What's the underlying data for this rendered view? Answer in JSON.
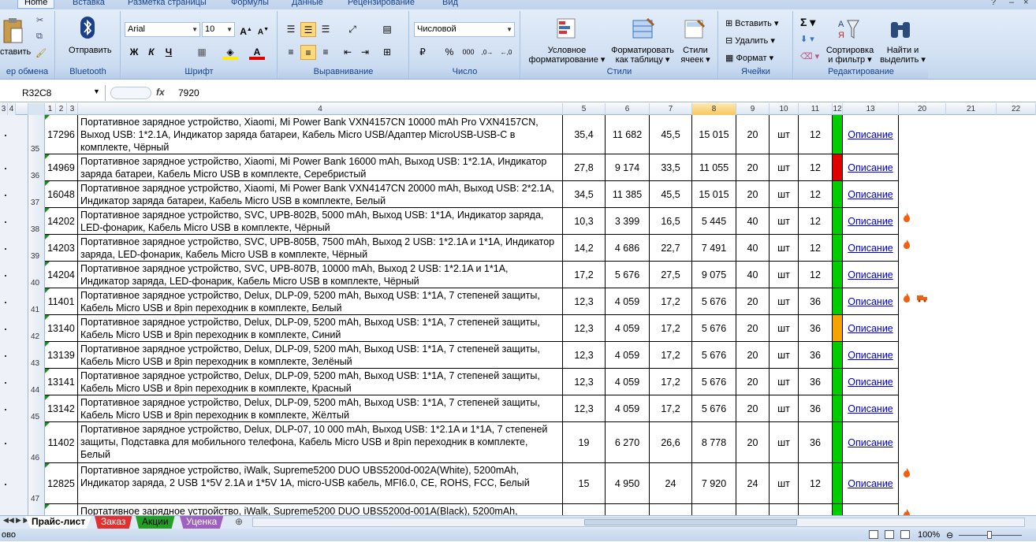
{
  "ribbon": {
    "tabs": [
      "Home",
      "Вставка",
      "Разметка страницы",
      "Формулы",
      "Данные",
      "Рецензирование",
      "Вид"
    ],
    "clipboard": {
      "paste": "ставить",
      "label": "ер обмена"
    },
    "bluetooth": {
      "send": "Отправить",
      "label": "Bluetooth"
    },
    "font": {
      "name": "Arial",
      "size": "10",
      "label": "Шрифт",
      "bold": "Ж",
      "italic": "К",
      "underline": "Ч"
    },
    "align": {
      "label": "Выравнивание"
    },
    "number": {
      "format": "Числовой",
      "label": "Число"
    },
    "styles": {
      "cond": "Условное",
      "cond2": "форматирование",
      "table": "Форматировать",
      "table2": "как таблицу",
      "cell": "Стили",
      "cell2": "ячеек",
      "label": "Стили"
    },
    "cells": {
      "insert": "Вставить",
      "delete": "Удалить",
      "format": "Формат",
      "label": "Ячейки"
    },
    "edit": {
      "sort": "Сортировка",
      "sort2": "и фильтр",
      "find": "Найти и",
      "find2": "выделить",
      "label": "Редактирование"
    }
  },
  "formula_bar": {
    "name_box": "R32C8",
    "fx": "fx",
    "value": "7920"
  },
  "column_headers": {
    "levels": [
      "3",
      "4"
    ],
    "sub": [
      "1",
      "2",
      "3"
    ],
    "cols": [
      "4",
      "5",
      "6",
      "7",
      "8",
      "9",
      "10",
      "11",
      "12",
      "13",
      "20",
      "21",
      "22"
    ]
  },
  "rows": [
    {
      "num": "35",
      "code": "17296",
      "desc": "Портативное зарядное устройство, Xiaomi, Mi Power Bank VXN4157CN 10000 mAh Pro VXN4157CN, Выход USB: 1*2.1A, Индикатор заряда батареи, Кабель Micro USB/Адаптер MicroUSB-USB-C в комплекте, Чёрный",
      "c5": "35,4",
      "c6": "11 682",
      "c7": "45,5",
      "c8": "15 015",
      "c9": "20",
      "c10": "шт",
      "c11": "12",
      "status": "#00cc00",
      "link": "Описание",
      "flames": 0
    },
    {
      "num": "36",
      "code": "14969",
      "desc": "Портативное зарядное устройство, Xiaomi, Mi Power Bank 16000 mAh, Выход USB: 1*2.1A, Индикатор заряда батареи, Кабель Micro USB в комплекте, Серебристый",
      "c5": "27,8",
      "c6": "9 174",
      "c7": "33,5",
      "c8": "11 055",
      "c9": "20",
      "c10": "шт",
      "c11": "12",
      "status": "#e00000",
      "link": "Описание",
      "flames": 0
    },
    {
      "num": "37",
      "code": "16048",
      "desc": "Портативное зарядное устройство, Xiaomi, Mi Power Bank VXN4147CN 20000 mAh, Выход USB: 2*2.1A, Индикатор заряда батареи, Кабель Micro USB в комплекте, Белый",
      "c5": "34,5",
      "c6": "11 385",
      "c7": "45,5",
      "c8": "15 015",
      "c9": "20",
      "c10": "шт",
      "c11": "12",
      "status": "#00cc00",
      "link": "Описание",
      "flames": 0
    },
    {
      "num": "38",
      "code": "14202",
      "desc": "Портативное зарядное устройство, SVC, UPB-802B, 5000 mAh, Выход USB: 1*1A, Индикатор заряда, LED-фонарик, Кабель Micro USB в комплекте, Чёрный",
      "c5": "10,3",
      "c6": "3 399",
      "c7": "16,5",
      "c8": "5 445",
      "c9": "40",
      "c10": "шт",
      "c11": "12",
      "status": "#00cc00",
      "link": "Описание",
      "flames": 1
    },
    {
      "num": "39",
      "code": "14203",
      "desc": "Портативное зарядное устройство, SVC, UPB-805B, 7500 mAh, Выход 2 USB: 1*2.1A и 1*1A, Индикатор заряда, LED-фонарик, Кабель Micro USB в комплекте, Чёрный",
      "c5": "14,2",
      "c6": "4 686",
      "c7": "22,7",
      "c8": "7 491",
      "c9": "40",
      "c10": "шт",
      "c11": "12",
      "status": "#00cc00",
      "link": "Описание",
      "flames": 1
    },
    {
      "num": "40",
      "code": "14204",
      "desc": "Портативное зарядное устройство, SVC, UPB-807B, 10000 mAh, Выход 2 USB: 1*2.1A и 1*1A, Индикатор заряда, LED-фонарик, Кабель Micro USB в комплекте, Чёрный",
      "c5": "17,2",
      "c6": "5 676",
      "c7": "27,5",
      "c8": "9 075",
      "c9": "40",
      "c10": "шт",
      "c11": "12",
      "status": "#00cc00",
      "link": "Описание",
      "flames": 0
    },
    {
      "num": "41",
      "code": "11401",
      "desc": "Портативное зарядное устройство, Delux, DLP-09, 5200 mAh, Выход USB: 1*1A, 7 степеней защиты, Кабель Micro USB и 8pin переходник в комплекте, Белый",
      "c5": "12,3",
      "c6": "4 059",
      "c7": "17,2",
      "c8": "5 676",
      "c9": "20",
      "c10": "шт",
      "c11": "36",
      "status": "#00cc00",
      "link": "Описание",
      "flames": 2
    },
    {
      "num": "42",
      "code": "13140",
      "desc": "Портативное зарядное устройство, Delux, DLP-09, 5200 mAh, Выход USB: 1*1A, 7 степеней защиты, Кабель Micro USB и 8pin переходник в комплекте, Синий",
      "c5": "12,3",
      "c6": "4 059",
      "c7": "17,2",
      "c8": "5 676",
      "c9": "20",
      "c10": "шт",
      "c11": "36",
      "status": "#f4a300",
      "link": "Описание",
      "flames": 0
    },
    {
      "num": "43",
      "code": "13139",
      "desc": "Портативное зарядное устройство, Delux, DLP-09, 5200 mAh, Выход USB: 1*1A, 7 степеней защиты, Кабель Micro USB и 8pin переходник в комплекте, Зелёный",
      "c5": "12,3",
      "c6": "4 059",
      "c7": "17,2",
      "c8": "5 676",
      "c9": "20",
      "c10": "шт",
      "c11": "36",
      "status": "#00cc00",
      "link": "Описание",
      "flames": 0
    },
    {
      "num": "44",
      "code": "13141",
      "desc": "Портативное зарядное устройство, Delux, DLP-09, 5200 mAh, Выход USB: 1*1A, 7 степеней защиты, Кабель Micro USB и 8pin переходник в комплекте, Красный",
      "c5": "12,3",
      "c6": "4 059",
      "c7": "17,2",
      "c8": "5 676",
      "c9": "20",
      "c10": "шт",
      "c11": "36",
      "status": "#00cc00",
      "link": "Описание",
      "flames": 0
    },
    {
      "num": "45",
      "code": "13142",
      "desc": "Портативное зарядное устройство, Delux, DLP-09, 5200 mAh, Выход USB: 1*1A, 7 степеней защиты, Кабель Micro USB и 8pin переходник в комплекте, Жёлтый",
      "c5": "12,3",
      "c6": "4 059",
      "c7": "17,2",
      "c8": "5 676",
      "c9": "20",
      "c10": "шт",
      "c11": "36",
      "status": "#00cc00",
      "link": "Описание",
      "flames": 0
    },
    {
      "num": "46",
      "code": "11402",
      "desc": "Портативное зарядное устройство, Delux, DLP-07, 10 000 mAh, Выход USB: 1*2.1A и 1*1A, 7 степеней защиты, Подставка для мобильного телефона, Кабель Micro USB и 8pin переходник в комплекте, Белый",
      "c5": "19",
      "c6": "6 270",
      "c7": "26,6",
      "c8": "8 778",
      "c9": "20",
      "c10": "шт",
      "c11": "36",
      "status": "#00cc00",
      "link": "Описание",
      "flames": 0
    },
    {
      "num": "47",
      "code": "12825",
      "desc": "Портативное зарядное устройство, iWalk, Supreme5200 DUO UBS5200d-002A(White), 5200mAh, Индикатор заряда, 2 USB 1*5V 2.1A и 1*5V 1A, micro-USB кабель, MFI6.0, CE, ROHS, FCC, Белый",
      "c5": "15",
      "c6": "4 950",
      "c7": "24",
      "c8": "7 920",
      "c9": "24",
      "c10": "шт",
      "c11": "12",
      "status": "#00cc00",
      "link": "Описание",
      "flames": 1
    },
    {
      "num": "",
      "code": "",
      "desc": "Портативное зарядное устройство, iWalk, Supreme5200 DUO UBS5200d-001A(Black), 5200mAh,",
      "c5": "",
      "c6": "",
      "c7": "",
      "c8": "",
      "c9": "",
      "c10": "",
      "c11": "",
      "status": "#00cc00",
      "link": "",
      "flames": 1
    }
  ],
  "sheet_tabs": [
    {
      "label": "Прайс-лист",
      "color": "#ffffff"
    },
    {
      "label": "Заказ",
      "color": "#e03030"
    },
    {
      "label": "Акции",
      "color": "#22a022"
    },
    {
      "label": "Уценка",
      "color": "#a060c0"
    }
  ],
  "status": {
    "left": "ово",
    "zoom": "100%"
  }
}
